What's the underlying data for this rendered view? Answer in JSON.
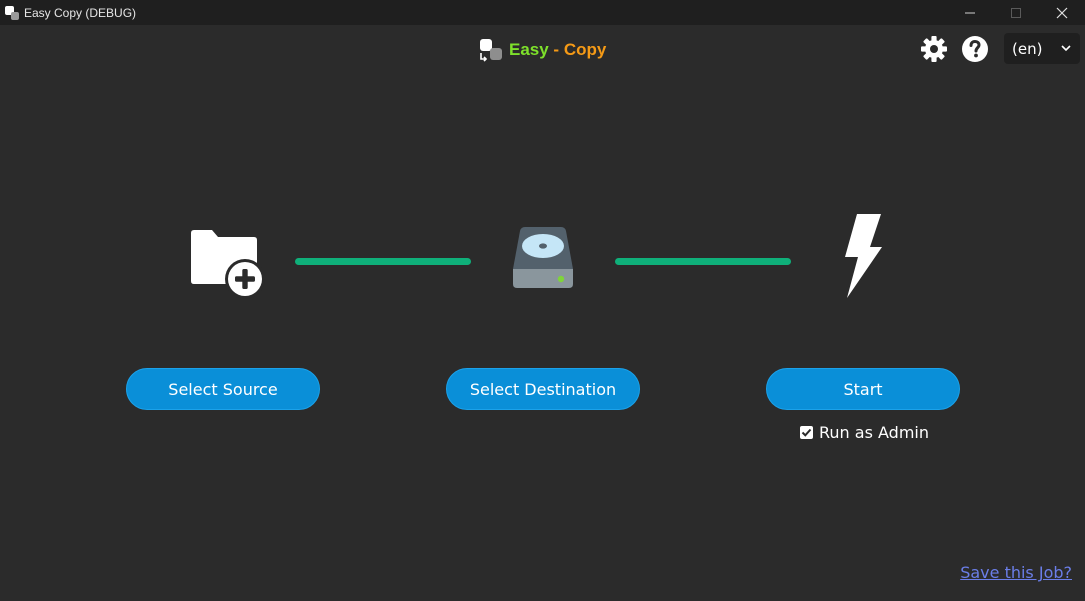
{
  "window": {
    "title": "Easy Copy (DEBUG)",
    "controls": [
      "minimize",
      "maximize",
      "close"
    ]
  },
  "header": {
    "brand_easy": "Easy",
    "brand_sep": " - ",
    "brand_copy": "Copy",
    "icons": [
      "gear-icon",
      "help-icon"
    ],
    "language": "(en)"
  },
  "steps": {
    "source_button": "Select Source",
    "destination_button": "Select Destination",
    "start_button": "Start",
    "run_as_admin_label": "Run as Admin",
    "run_as_admin_checked": true
  },
  "footer": {
    "save_job_link": "Save this Job?"
  },
  "colors": {
    "background": "#2b2b2b",
    "titlebar": "#1f1f1f",
    "accent_button": "#0a8fd8",
    "connector": "#0fb07a",
    "brand_easy": "#7ee02b",
    "brand_copy": "#f59a16",
    "link": "#6b7ee8"
  }
}
